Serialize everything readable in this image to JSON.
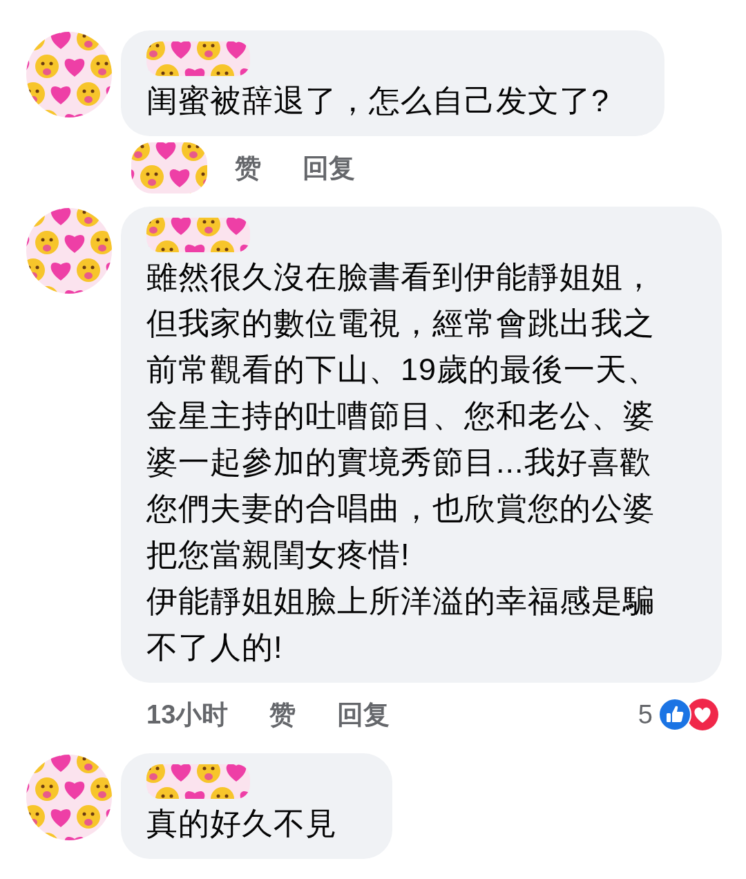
{
  "comments": [
    {
      "paragraphs": [
        "闺蜜被辞退了，怎么自己发文了?"
      ],
      "like_label": "赞",
      "reply_label": "回复"
    },
    {
      "paragraphs": [
        "雖然很久沒在臉書看到伊能靜姐姐，但我家的數位電視，經常會跳出我之前常觀看的下山、19歲的最後一天、金星主持的吐嘈節目、您和老公、婆婆一起參加的實境秀節目...我好喜歡您們夫妻的合唱曲，也欣賞您的公婆把您當親閨女疼惜!",
        "伊能靜姐姐臉上所洋溢的幸福感是騙不了人的!"
      ],
      "time": "13小时",
      "like_label": "赞",
      "reply_label": "回复",
      "reactions": {
        "count": "5"
      }
    },
    {
      "paragraphs": [
        "真的好久不見"
      ]
    }
  ]
}
